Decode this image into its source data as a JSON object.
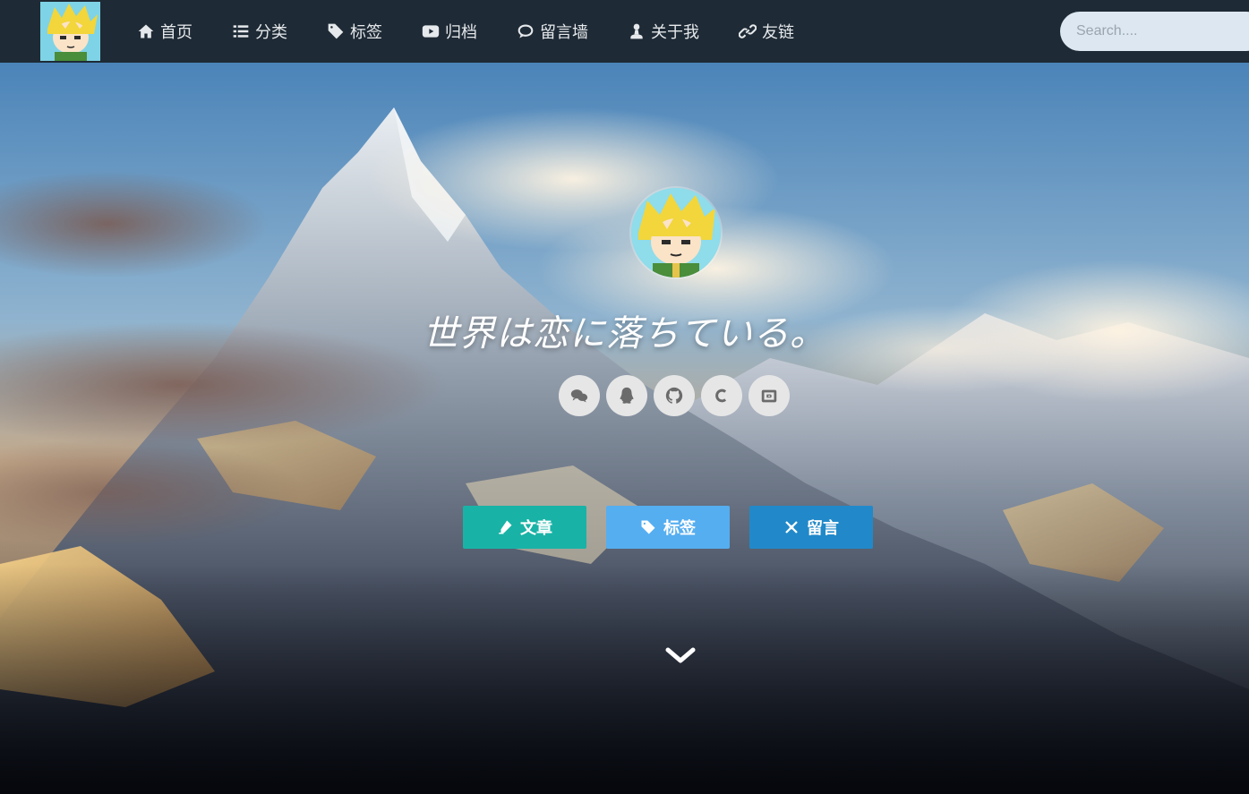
{
  "nav": {
    "logo_alt": "site-avatar",
    "items": [
      {
        "label": "首页",
        "icon": "home-icon"
      },
      {
        "label": "分类",
        "icon": "list-icon"
      },
      {
        "label": "标签",
        "icon": "tag-icon"
      },
      {
        "label": "归档",
        "icon": "video-icon"
      },
      {
        "label": "留言墙",
        "icon": "comments-icon"
      },
      {
        "label": "关于我",
        "icon": "user-icon"
      },
      {
        "label": "友链",
        "icon": "link-icon"
      }
    ],
    "search_placeholder": "Search...."
  },
  "hero": {
    "motto": "世界は恋に落ちている。",
    "socials": [
      {
        "icon": "wechat-icon"
      },
      {
        "icon": "qq-icon"
      },
      {
        "icon": "github-icon"
      },
      {
        "icon": "csdn-icon"
      },
      {
        "icon": "bilibili-icon"
      }
    ],
    "buttons": [
      {
        "label": "文章",
        "icon": "pen-icon",
        "color": "#18b3a6"
      },
      {
        "label": "标签",
        "icon": "tag-icon",
        "color": "#55aef0"
      },
      {
        "label": "留言",
        "icon": "pin-icon",
        "color": "#2189c9"
      }
    ]
  },
  "colors": {
    "navbar_bg": "#1e2a35",
    "search_bg": "#dce7f1"
  }
}
